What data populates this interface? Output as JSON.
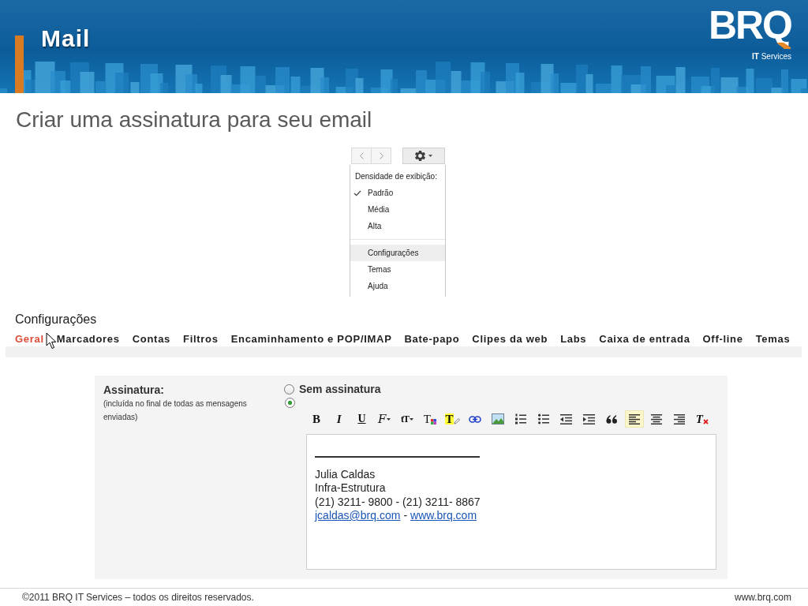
{
  "header": {
    "title": "Mail",
    "logo": "BRQ",
    "logo_tagline": "**IT** Services"
  },
  "page_title": "Criar uma assinatura para seu email",
  "gmail_menu": {
    "density_heading": "Densidade de exibição:",
    "density_options": [
      {
        "label": "Padrão",
        "checked": true
      },
      {
        "label": "Média",
        "checked": false
      },
      {
        "label": "Alta",
        "checked": false
      }
    ],
    "items": [
      {
        "label": "Configurações",
        "highlighted": true
      },
      {
        "label": "Temas",
        "highlighted": false
      },
      {
        "label": "Ajuda",
        "highlighted": false
      }
    ]
  },
  "settings": {
    "heading": "Configurações",
    "tabs": [
      {
        "label": "Geral",
        "selected": true
      },
      {
        "label": "Marcadores",
        "selected": false
      },
      {
        "label": "Contas",
        "selected": false
      },
      {
        "label": "Filtros",
        "selected": false
      },
      {
        "label": "Encaminhamento e POP/IMAP",
        "selected": false
      },
      {
        "label": "Bate-papo",
        "selected": false
      },
      {
        "label": "Clipes da web",
        "selected": false
      },
      {
        "label": "Labs",
        "selected": false
      },
      {
        "label": "Caixa de entrada",
        "selected": false
      },
      {
        "label": "Off-line",
        "selected": false
      },
      {
        "label": "Temas",
        "selected": false
      }
    ]
  },
  "signature": {
    "label": "Assinatura:",
    "note": "(incluída no final de todas as mensagens enviadas)",
    "options": [
      {
        "label": "Sem assinatura",
        "selected": false
      },
      {
        "selected": true
      }
    ],
    "toolbar": [
      {
        "kind": "bold",
        "label": "B",
        "active": false
      },
      {
        "kind": "italic",
        "label": "I",
        "active": false
      },
      {
        "kind": "underline",
        "label": "U",
        "active": false
      },
      {
        "kind": "font",
        "label": "F",
        "active": false
      },
      {
        "kind": "size",
        "label": "tT",
        "active": false
      },
      {
        "kind": "text_color",
        "label": "T",
        "active": false
      },
      {
        "kind": "highlight",
        "label": "T",
        "active": false
      },
      {
        "kind": "link",
        "active": false
      },
      {
        "kind": "image",
        "active": false
      },
      {
        "kind": "numbered_list",
        "active": false
      },
      {
        "kind": "bulleted_list",
        "active": false
      },
      {
        "kind": "outdent",
        "active": false
      },
      {
        "kind": "indent",
        "active": false
      },
      {
        "kind": "quote",
        "active": false
      },
      {
        "kind": "align_left",
        "active": true
      },
      {
        "kind": "align_center",
        "active": false
      },
      {
        "kind": "align_right",
        "active": false
      },
      {
        "kind": "remove_formatting",
        "label": "T",
        "active": false
      }
    ],
    "editor": {
      "lines": [
        "Julia Caldas",
        "Infra-Estrutura",
        "(21) 3211- 9800 - (21) 3211- 8867"
      ],
      "email": "jcaldas@brq.com",
      "separator": "-",
      "website": "www.brq.com"
    }
  },
  "footer": {
    "copyright": "©2011 BRQ IT Services – todos os direitos reservados.",
    "website": "www.brq.com"
  }
}
